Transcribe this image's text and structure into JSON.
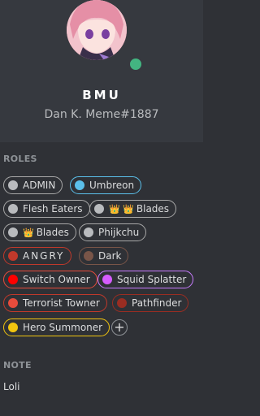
{
  "profile": {
    "username": "BMU",
    "tag": "Dan K. Meme#1887",
    "status_color": "#43b581"
  },
  "roles_section": {
    "title": "ROLES",
    "add_button_label": "+",
    "roles": [
      {
        "label": "ADMIN",
        "dot_color": "#b9bbbe",
        "border_color": "#a8a8a8"
      },
      {
        "label": "Umbreon",
        "dot_color": "#5bc0eb",
        "border_color": "#5bc0eb"
      },
      {
        "label": "Flesh Eaters",
        "dot_color": "#b9bbbe",
        "border_color": "#a8a8a8"
      },
      {
        "label": "Blades",
        "crowns": "👑 👑",
        "dot_color": "#b9bbbe",
        "border_color": "#a8a8a8"
      },
      {
        "label": "Blades",
        "crowns": "👑",
        "dot_color": "#b9bbbe",
        "border_color": "#a8a8a8"
      },
      {
        "label": "Phijkchu",
        "dot_color": "#b9bbbe",
        "border_color": "#a8a8a8"
      },
      {
        "label": "ANGRY",
        "dot_color": "#c0392b",
        "border_color": "#c0392b"
      },
      {
        "label": "Dark",
        "dot_color": "#795548",
        "border_color": "#795548"
      },
      {
        "label": "Switch Owner",
        "dot_color": "#ff0000",
        "border_color": "#e74c3c"
      },
      {
        "label": "Squid Splatter",
        "dot_color": "#d65cff",
        "border_color": "#c87cff"
      },
      {
        "label": "Terrorist Towner",
        "dot_color": "#e74c3c",
        "border_color": "#c0392b"
      },
      {
        "label": "Pathfinder",
        "dot_color": "#992d22",
        "border_color": "#992d22"
      },
      {
        "label": "Hero Summoner",
        "dot_color": "#f1c40f",
        "border_color": "#f1c40f"
      }
    ]
  },
  "note_section": {
    "title": "NOTE",
    "text": "Loli"
  }
}
